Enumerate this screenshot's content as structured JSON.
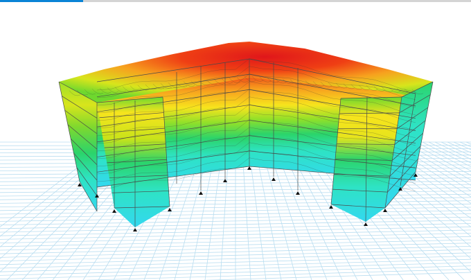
{
  "viewport": {
    "kind": "3d-structural-model-view",
    "background": "#ffffff",
    "grid_color": "#b8ddf0",
    "frame_color": "#4a4a4a",
    "support_color": "#111111",
    "accent_bar_color": "#0a84d6"
  },
  "contour_colors": [
    "#33d8f0",
    "#2ee3c4",
    "#2bd46b",
    "#6ed82e",
    "#bfe31a",
    "#f7e41d",
    "#f7b21e",
    "#f57a1b",
    "#ef3f14",
    "#e0161a"
  ]
}
